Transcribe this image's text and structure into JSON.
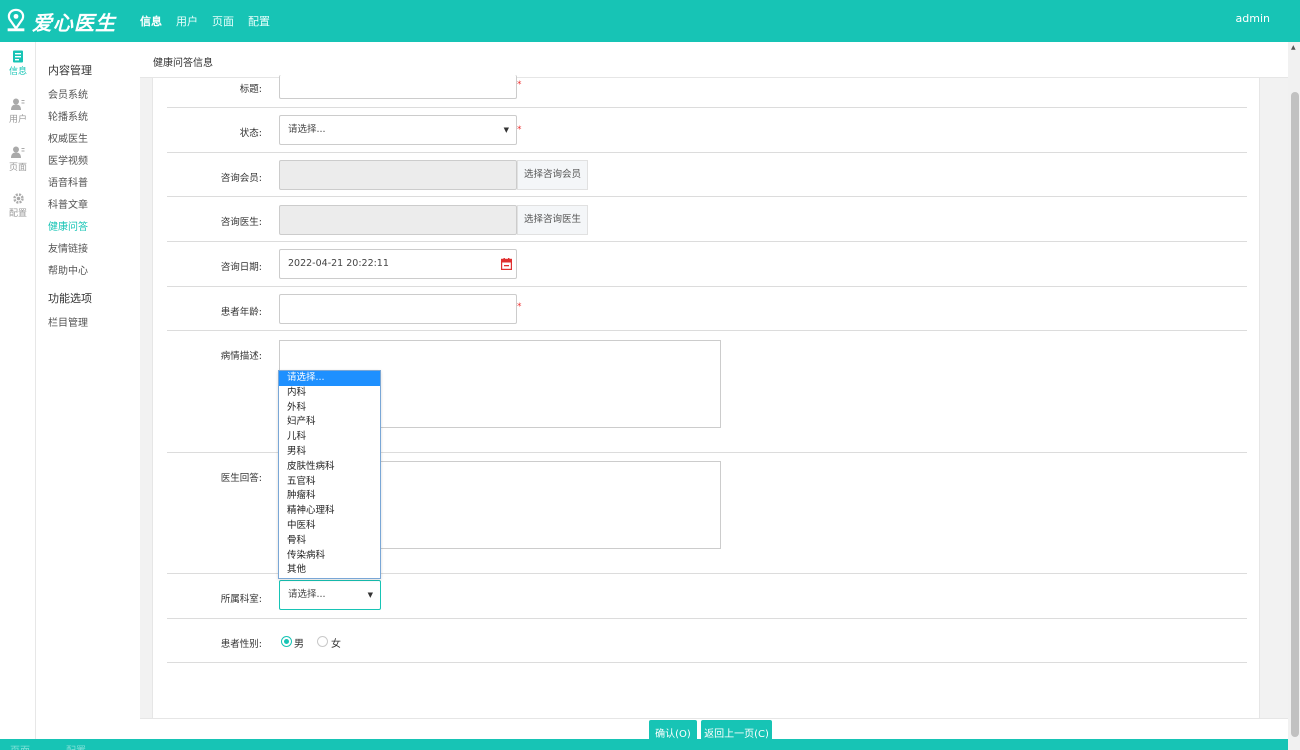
{
  "brand": {
    "name": "爱心医生",
    "accent": "#17c4b5"
  },
  "topnav": {
    "items": [
      "信息",
      "用户",
      "页面",
      "配置"
    ],
    "active": "信息",
    "user": "admin"
  },
  "rail": {
    "items": [
      {
        "label": "信息",
        "icon": "doc-icon"
      },
      {
        "label": "用户",
        "icon": "user-icon"
      },
      {
        "label": "页面",
        "icon": "user-icon"
      },
      {
        "label": "配置",
        "icon": "gear-icon"
      }
    ]
  },
  "menu": {
    "group1": "内容管理",
    "items": [
      "会员系统",
      "轮播系统",
      "权威医生",
      "医学视频",
      "语音科普",
      "科普文章",
      "健康问答",
      "友情链接",
      "帮助中心"
    ],
    "active": "健康问答",
    "group2": "功能选项",
    "items2": [
      "栏目管理"
    ]
  },
  "page": {
    "title": "健康问答信息"
  },
  "form": {
    "title_label": "标题:",
    "title_value": "",
    "status_label": "状态:",
    "status_value": "请选择...",
    "member_label": "咨询会员:",
    "member_button": "选择咨询会员",
    "doctor_label": "咨询医生:",
    "doctor_button": "选择咨询医生",
    "date_label": "咨询日期:",
    "date_value": "2022-04-21 20:22:11",
    "age_label": "患者年龄:",
    "desc_label": "病情描述:",
    "answer_label": "医生回答:",
    "dept_label": "所属科室:",
    "dept_value": "请选择...",
    "gender_label": "患者性别:",
    "gender_options": [
      "男",
      "女"
    ],
    "gender_selected": "男",
    "required_mark": "*"
  },
  "dept_dropdown": {
    "options": [
      "请选择...",
      "内科",
      "外科",
      "妇产科",
      "儿科",
      "男科",
      "皮肤性病科",
      "五官科",
      "肿瘤科",
      "精神心理科",
      "中医科",
      "骨科",
      "传染病科",
      "其他"
    ],
    "highlighted": "请选择..."
  },
  "buttons": {
    "confirm": "确认(O)",
    "back": "返回上一页(C)"
  },
  "footer": {
    "items": [
      "页面",
      "配置"
    ]
  }
}
